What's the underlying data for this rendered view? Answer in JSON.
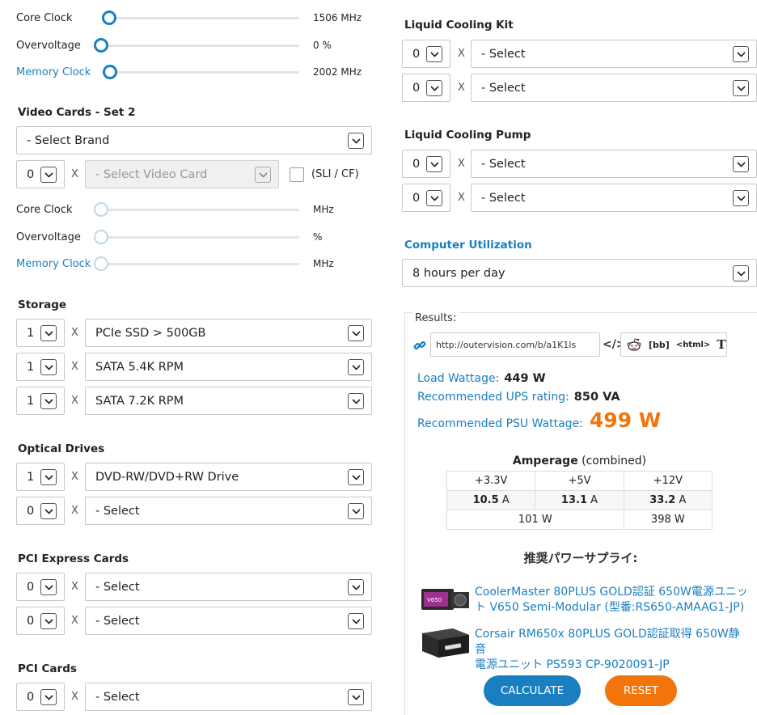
{
  "set1_sliders": {
    "core_clock": {
      "label": "Core Clock",
      "value": "1506 MHz"
    },
    "overvoltage": {
      "label": "Overvoltage",
      "value": "0 %"
    },
    "memory_clock": {
      "label": "Memory Clock",
      "value": "2002 MHz"
    }
  },
  "video_cards_set2": {
    "heading": "Video Cards - Set 2",
    "brand": "- Select Brand",
    "qty": "0",
    "x": "X",
    "card": "- Select Video Card",
    "sli_label": "(SLI / CF)",
    "core_clock": {
      "label": "Core Clock",
      "unit": "MHz"
    },
    "overvoltage": {
      "label": "Overvoltage",
      "unit": "%"
    },
    "memory_clock": {
      "label": "Memory Clock",
      "unit": "MHz"
    }
  },
  "storage": {
    "heading": "Storage",
    "rows": [
      {
        "qty": "1",
        "x": "X",
        "value": "PCIe SSD > 500GB"
      },
      {
        "qty": "1",
        "x": "X",
        "value": "SATA 5.4K RPM"
      },
      {
        "qty": "1",
        "x": "X",
        "value": "SATA 7.2K RPM"
      }
    ]
  },
  "optical": {
    "heading": "Optical Drives",
    "rows": [
      {
        "qty": "1",
        "x": "X",
        "value": "DVD-RW/DVD+RW Drive"
      },
      {
        "qty": "0",
        "x": "X",
        "value": "- Select"
      }
    ]
  },
  "pcie": {
    "heading": "PCI Express Cards",
    "rows": [
      {
        "qty": "0",
        "x": "X",
        "value": "- Select"
      },
      {
        "qty": "0",
        "x": "X",
        "value": "- Select"
      }
    ]
  },
  "pci": {
    "heading": "PCI Cards",
    "rows": [
      {
        "qty": "0",
        "x": "X",
        "value": "- Select"
      }
    ]
  },
  "liquid_kit": {
    "heading": "Liquid Cooling Kit",
    "rows": [
      {
        "qty": "0",
        "x": "X",
        "value": "- Select"
      },
      {
        "qty": "0",
        "x": "X",
        "value": "- Select"
      }
    ]
  },
  "liquid_pump": {
    "heading": "Liquid Cooling Pump",
    "rows": [
      {
        "qty": "0",
        "x": "X",
        "value": "- Select"
      },
      {
        "qty": "0",
        "x": "X",
        "value": "- Select"
      }
    ]
  },
  "utilization": {
    "heading": "Computer Utilization",
    "value": "8 hours per day"
  },
  "results": {
    "legend": "Results:",
    "url": "http://outervision.com/b/a1K1ls",
    "share_bb": "[bb]",
    "share_html": "<html>",
    "share_text": "T",
    "load_label": "Load Wattage:",
    "load_value": "449 W",
    "ups_label": "Recommended UPS rating:",
    "ups_value": "850 VA",
    "psu_label": "Recommended PSU Wattage:",
    "psu_value": "499 W",
    "amperage_bold": "Amperage",
    "amperage_rest": "(combined)",
    "rails": [
      "+3.3V",
      "+5V",
      "+12V"
    ],
    "amps": [
      {
        "num": "10.5",
        "unit": "A"
      },
      {
        "num": "13.1",
        "unit": "A"
      },
      {
        "num": "33.2",
        "unit": "A"
      }
    ],
    "watts_low": "101 W",
    "watts_12v": "398 W",
    "recommend_heading": "推奨パワーサプライ:",
    "products": [
      {
        "line1": "CoolerMaster 80PLUS GOLD認証 650W電源ユニッ",
        "line2": "ト V650 Semi-Modular (型番:RS650-AMAAG1-JP)"
      },
      {
        "line1": "Corsair RM650x 80PLUS GOLD認証取得 650W静音",
        "line2": "電源ユニット PS593 CP-9020091-JP"
      }
    ],
    "calculate": "CALCULATE",
    "reset": "RESET"
  },
  "colors": {
    "blue": "#1a7fc1",
    "orange": "#f2750c",
    "button_blue": "#1a7fc1",
    "button_orange": "#f2750c"
  },
  "icons": [
    "link-icon",
    "code-icon",
    "reddit-icon",
    "chevron-down-icon",
    "checkbox-icon"
  ]
}
